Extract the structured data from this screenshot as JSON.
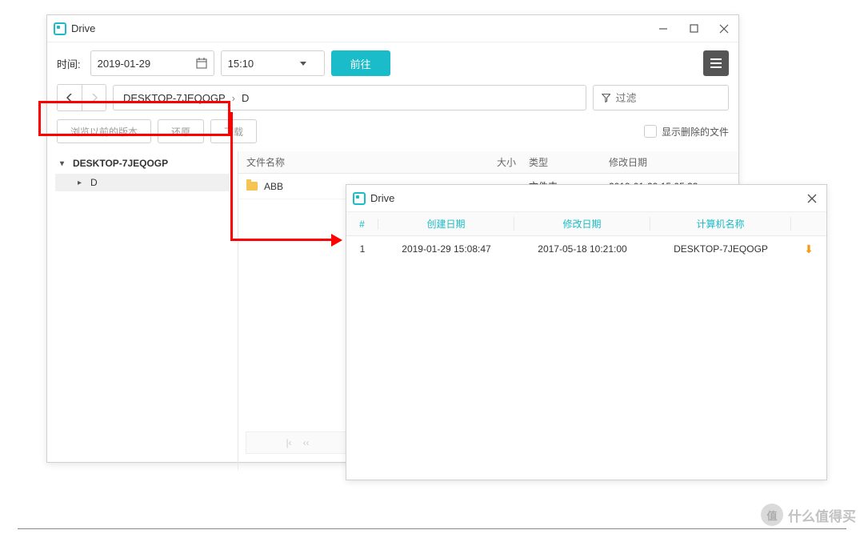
{
  "app": {
    "title": "Drive"
  },
  "toolbar": {
    "time_label": "时间:",
    "date_value": "2019-01-29",
    "time_value": "15:10",
    "go_button": "前往"
  },
  "breadcrumb": {
    "root": "DESKTOP-7JEQOGP",
    "sep": "›",
    "child": "D"
  },
  "filter": {
    "placeholder": "过滤"
  },
  "actions": {
    "browse_versions": "浏览以前的版本",
    "restore": "还原",
    "download": "下载",
    "show_deleted": "显示删除的文件"
  },
  "tree": {
    "root": "DESKTOP-7JEQOGP",
    "child": "D"
  },
  "file_headers": {
    "name": "文件名称",
    "size": "大小",
    "type": "类型",
    "modified": "修改日期"
  },
  "files": [
    {
      "name": "ABB",
      "size": "",
      "type": "文件夹",
      "modified": "2019-01-29 15:05:33"
    }
  ],
  "popup": {
    "title": "Drive",
    "headers": {
      "idx": "#",
      "created": "创建日期",
      "modified": "修改日期",
      "computer": "计算机名称"
    },
    "rows": [
      {
        "idx": "1",
        "created": "2019-01-29 15:08:47",
        "modified": "2017-05-18 10:21:00",
        "computer": "DESKTOP-7JEQOGP"
      }
    ]
  },
  "watermark": {
    "text": "什么值得买",
    "badge": "值"
  }
}
